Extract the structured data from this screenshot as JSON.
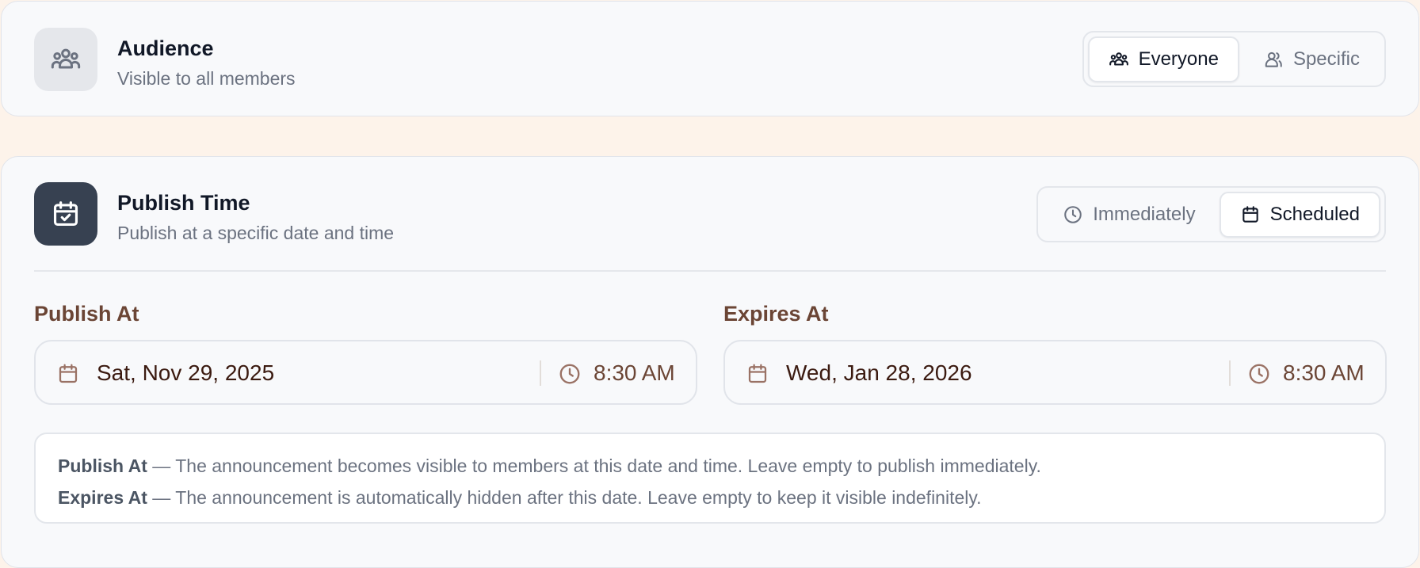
{
  "audience": {
    "title": "Audience",
    "subtitle": "Visible to all members",
    "icon": "users-icon",
    "options": [
      {
        "label": "Everyone",
        "icon": "users-icon",
        "active": true
      },
      {
        "label": "Specific",
        "icon": "user-icon",
        "active": false
      }
    ]
  },
  "publish_time": {
    "title": "Publish Time",
    "subtitle": "Publish at a specific date and time",
    "icon": "calendar-check-icon",
    "options": [
      {
        "label": "Immediately",
        "icon": "clock-icon",
        "active": false
      },
      {
        "label": "Scheduled",
        "icon": "calendar-icon",
        "active": true
      }
    ],
    "publish_at": {
      "label": "Publish At",
      "date": "Sat, Nov 29, 2025",
      "time": "8:30 AM"
    },
    "expires_at": {
      "label": "Expires At",
      "date": "Wed, Jan 28, 2026",
      "time": "8:30 AM"
    },
    "help": {
      "publish_term": "Publish At",
      "publish_text": " — The announcement becomes visible to members at this date and time. Leave empty to publish immediately.",
      "expires_term": "Expires At",
      "expires_text": " — The announcement is automatically hidden after this date. Leave empty to keep it visible indefinitely."
    }
  },
  "colors": {
    "page_bg": "#fdf3ea",
    "card_bg": "#f8f9fb",
    "accent_dark": "#374151",
    "label_brown": "#6b4535",
    "value_dark_brown": "#3b1a10"
  }
}
